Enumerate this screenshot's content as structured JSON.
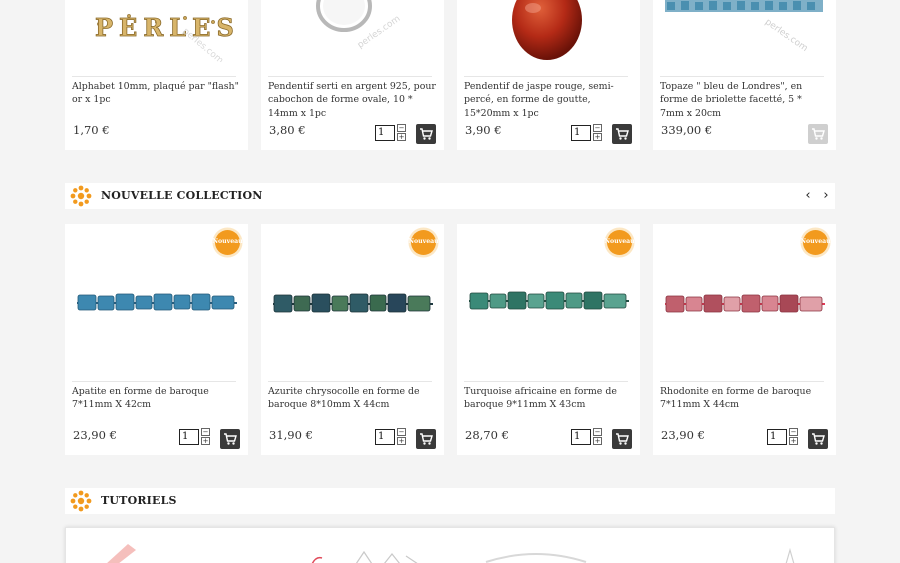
{
  "top_products": [
    {
      "name": "Alphabet 10mm, plaqué par \"flash\" or x 1pc",
      "price": "1,70 €",
      "has_cart": false,
      "image_text": "PERLES",
      "watermark": "perles.com"
    },
    {
      "name": "Pendentif serti en argent 925, pour cabochon de forme ovale, 10 * 14mm x 1pc",
      "price": "3,80 €",
      "has_cart": true,
      "qty": "1",
      "cart_enabled": true,
      "watermark": "perles.com"
    },
    {
      "name": "Pendentif de jaspe rouge, semi-percé, en forme de goutte, 15*20mm x 1pc",
      "price": "3,90 €",
      "has_cart": true,
      "qty": "1",
      "cart_enabled": true
    },
    {
      "name": "Topaze \" bleu de Londres\", en forme de briolette facetté, 5 * 7mm x 20cm",
      "price": "339,00 €",
      "has_cart": true,
      "cart_enabled": false,
      "watermark": "perles.com"
    }
  ],
  "nouvelle_collection": {
    "title": "NOUVELLE COLLECTION",
    "prev_label": "‹",
    "next_label": "›",
    "badge_label": "Nouveau",
    "products": [
      {
        "name": "Apatite en forme de baroque 7*11mm X 42cm",
        "price": "23,90 €",
        "qty": "1",
        "bead_color": "#3d88b0"
      },
      {
        "name": "Azurite chrysocolle en forme de baroque 8*10mm X 44cm",
        "price": "31,90 €",
        "qty": "1",
        "bead_color": "#2f5b66"
      },
      {
        "name": "Turquoise africaine en forme de baroque 9*11mm X 43cm",
        "price": "28,70 €",
        "qty": "1",
        "bead_color": "#3b8a78"
      },
      {
        "name": "Rhodonite en forme de baroque 7*11mm X 44cm",
        "price": "23,90 €",
        "qty": "1",
        "bead_color": "#c0606d"
      }
    ]
  },
  "tutoriels": {
    "title": "TUTORIELS"
  },
  "colors": {
    "accent_orange": "#f29a1e",
    "cart_dark": "#3a3a3a",
    "cart_disabled": "#cfcfcf"
  },
  "qty_controls": {
    "plus": "+",
    "minus": "−"
  }
}
